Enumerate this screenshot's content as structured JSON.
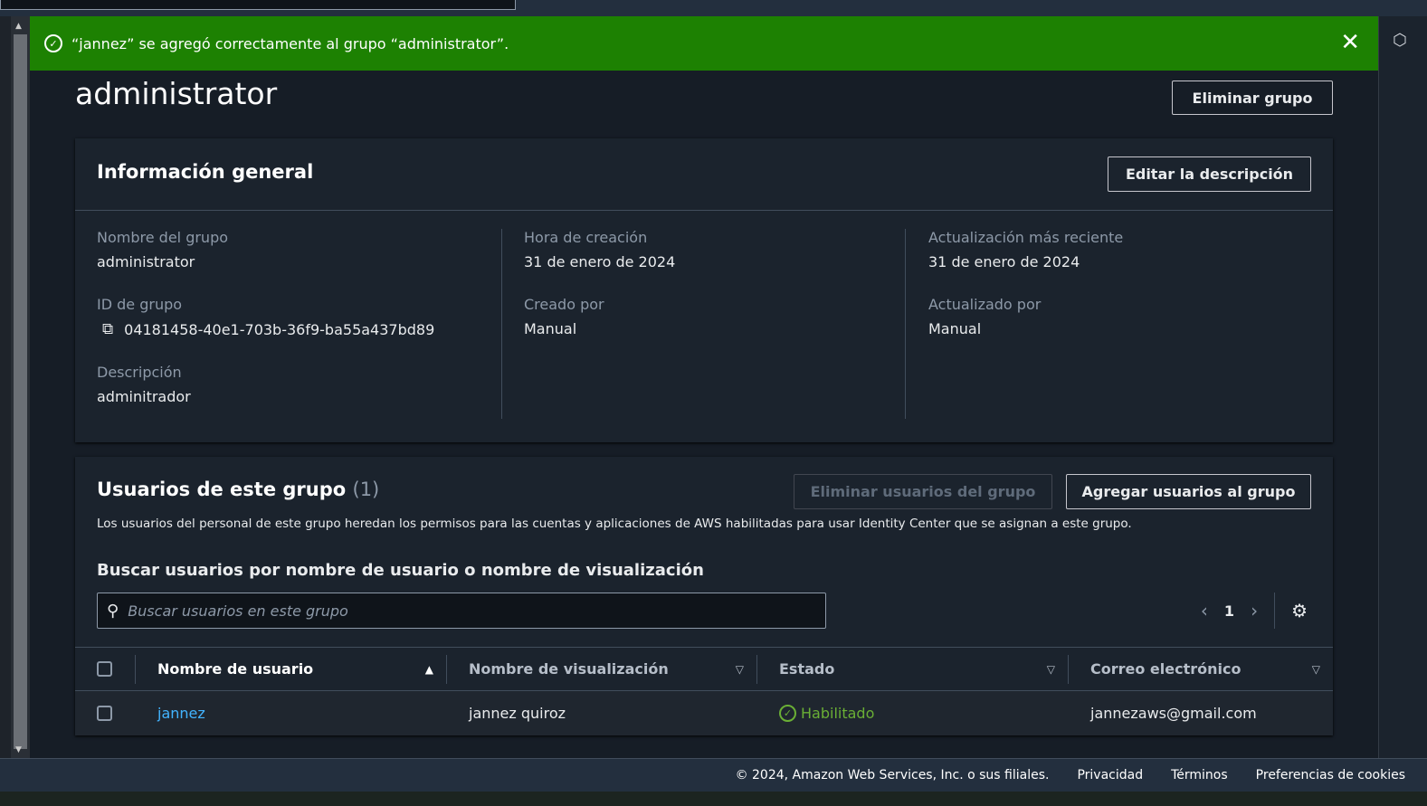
{
  "flash": {
    "message": "“jannez” se agregó correctamente al grupo “administrator”."
  },
  "page": {
    "title": "administrator",
    "delete_group": "Eliminar grupo"
  },
  "general": {
    "title": "Información general",
    "edit_label": "Editar la descripción",
    "group_name_label": "Nombre del grupo",
    "group_name": "administrator",
    "group_id_label": "ID de grupo",
    "group_id": "04181458-40e1-703b-36f9-ba55a437bd89",
    "description_label": "Descripción",
    "description": "adminitrador",
    "created_label": "Hora de creación",
    "created": "31 de enero de 2024",
    "created_by_label": "Creado por",
    "created_by": "Manual",
    "updated_label": "Actualización más reciente",
    "updated": "31 de enero de 2024",
    "updated_by_label": "Actualizado por",
    "updated_by": "Manual"
  },
  "users": {
    "title": "Usuarios de este grupo",
    "count": "(1)",
    "remove_label": "Eliminar usuarios del grupo",
    "add_label": "Agregar usuarios al grupo",
    "description": "Los usuarios del personal de este grupo heredan los permisos para las cuentas y aplicaciones de AWS habilitadas para usar Identity Center que se asignan a este grupo.",
    "search_label": "Buscar usuarios por nombre de usuario o nombre de visualización",
    "search_placeholder": "Buscar usuarios en este grupo",
    "page": "1",
    "columns": [
      "Nombre de usuario",
      "Nombre de visualización",
      "Estado",
      "Correo electrónico"
    ],
    "rows": [
      {
        "username": "jannez",
        "display_name": "jannez quiroz",
        "status": "Habilitado",
        "email": "jannezaws@gmail.com"
      }
    ]
  },
  "footer": {
    "copyright": "© 2024, Amazon Web Services, Inc. o sus filiales.",
    "privacy": "Privacidad",
    "terms": "Términos",
    "cookies": "Preferencias de cookies"
  },
  "colors": {
    "success": "#1d8102",
    "link": "#42b4ff",
    "enabled": "#6aaf35"
  }
}
